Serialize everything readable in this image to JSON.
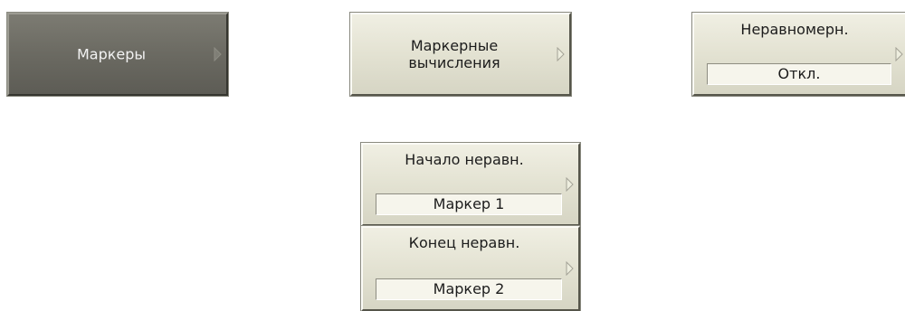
{
  "softkeys": {
    "markers": {
      "label": "Маркеры"
    },
    "marker_calc": {
      "line1": "Маркерные",
      "line2": "вычисления"
    },
    "flatness": {
      "label": "Неравномерн.",
      "value": "Откл."
    },
    "flatness_start": {
      "label": "Начало неравн.",
      "value": "Маркер 1"
    },
    "flatness_stop": {
      "label": "Конец неравн.",
      "value": "Маркер 2"
    }
  },
  "icons": {
    "submenu_arrow": "chevron-right-icon"
  },
  "colors": {
    "button_face": "#e3e2d2",
    "active_face": "#6b6a62",
    "value_field": "#f6f5ec"
  }
}
